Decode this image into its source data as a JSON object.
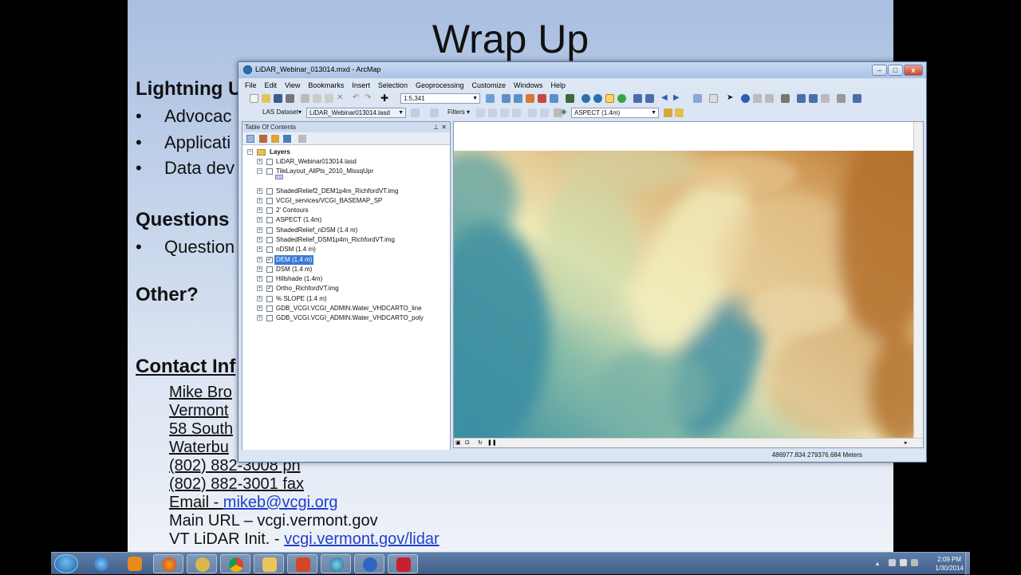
{
  "slide": {
    "title": "Wrap Up",
    "sections": {
      "lightning": "Lightning U",
      "questions": "Questions",
      "other": "Other?",
      "contact": "Contact Inf"
    },
    "bullets_lightning": [
      "Advocac",
      "Applicati",
      "Data dev"
    ],
    "bullets_questions": [
      "Question"
    ],
    "contact_lines": [
      "Mike Bro",
      "Vermont",
      "58 South",
      "Waterbu",
      "(802) 882-3008 ph",
      "(802) 882-3001 fax"
    ],
    "email_label": "Email - ",
    "email_link": "mikeb@vcgi.org",
    "main_url": "Main URL – vcgi.vermont.gov",
    "lidar_label": "VT LiDAR Init.  - ",
    "lidar_link": "vcgi.vermont.gov/lidar"
  },
  "window": {
    "title": "LiDAR_Webinar_013014.mxd - ArcMap",
    "min": "–",
    "max": "□",
    "close": "x"
  },
  "menu": [
    "File",
    "Edit",
    "View",
    "Bookmarks",
    "Insert",
    "Selection",
    "Geoprocessing",
    "Customize",
    "Windows",
    "Help"
  ],
  "toolbar": {
    "scale_value": "1:5,341",
    "las_dataset_label": "LAS Dataset",
    "las_dataset_value": "LiDAR_Webinar013014.lasd",
    "filters_label": "Filters",
    "layer_dropdown_value": "ASPECT (1.4m)"
  },
  "toc": {
    "title": "Table Of Contents",
    "root": "Layers",
    "layers": [
      {
        "name": "LiDAR_Webinar013014.lasd",
        "checked": false,
        "expander": "+"
      },
      {
        "name": "TileLayout_AllPts_2010_MissqUpr",
        "checked": false,
        "expander": "−"
      },
      {
        "name": "ShadedRelief2_DEM1p4m_RichfordVT.img",
        "checked": false,
        "expander": "+"
      },
      {
        "name": "VCGI_services/VCGI_BASEMAP_SP",
        "checked": false,
        "expander": "+"
      },
      {
        "name": "2' Contours",
        "checked": false,
        "expander": "+"
      },
      {
        "name": "ASPECT (1.4m)",
        "checked": false,
        "expander": "+"
      },
      {
        "name": "ShadedRelief_nDSM (1.4 m)",
        "checked": false,
        "expander": "+"
      },
      {
        "name": "ShadedRelief_DSM1p4m_RichfordVT.img",
        "checked": false,
        "expander": "+"
      },
      {
        "name": "nDSM (1.4 m)",
        "checked": false,
        "expander": "+"
      },
      {
        "name": "DEM (1.4 m)",
        "checked": true,
        "expander": "+",
        "selected": true
      },
      {
        "name": "DSM (1.4 m)",
        "checked": false,
        "expander": "+"
      },
      {
        "name": "Hillshade (1.4m)",
        "checked": false,
        "expander": "+"
      },
      {
        "name": "Ortho_RichfordVT.img",
        "checked": true,
        "expander": "+"
      },
      {
        "name": "% SLOPE (1.4 m)",
        "checked": false,
        "expander": "+"
      },
      {
        "name": "GDB_VCGI.VCGI_ADMIN.Water_VHDCARTO_line",
        "checked": false,
        "expander": "+"
      },
      {
        "name": "GDB_VCGI.VCGI_ADMIN.Water_VHDCARTO_poly",
        "checked": false,
        "expander": "+"
      }
    ]
  },
  "status": {
    "coordinates": "486977.834  279376.684 Meters"
  },
  "taskbar": {
    "time": "2:09 PM",
    "date": "1/30/2014",
    "apps": [
      "ie-icon",
      "media-player-icon",
      "firefox-icon",
      "paint-icon",
      "chrome-icon",
      "explorer-icon",
      "powerpoint-icon",
      "arcmap-icon",
      "snowflake-icon",
      "mcafee-icon"
    ]
  },
  "colors": {
    "dem_low": "#3f8ea0",
    "dem_mid": "#f4eeb8",
    "dem_high": "#b5742c",
    "selection": "#3a7ad6",
    "link": "#1f3fcc"
  }
}
